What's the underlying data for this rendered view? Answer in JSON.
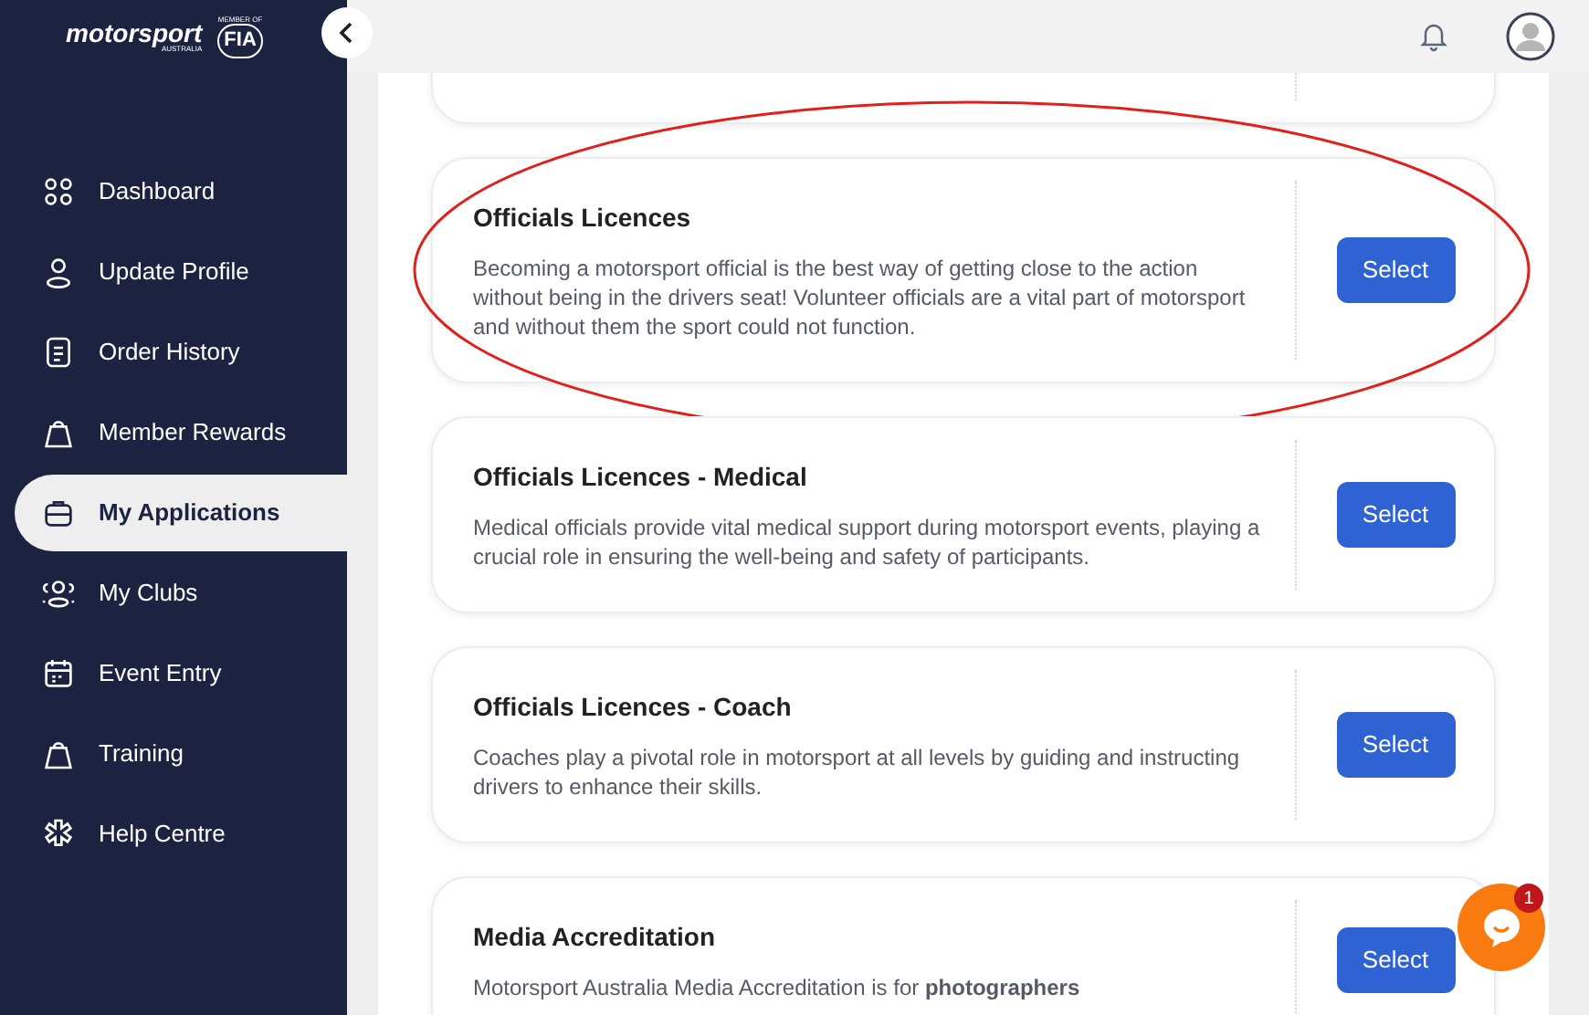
{
  "logo": {
    "wordmark": "motorsport",
    "subtitle": "AUSTRALIA",
    "member_label": "MEMBER OF",
    "fia": "FIA"
  },
  "sidebar": {
    "items": [
      {
        "label": "Dashboard",
        "selected": false
      },
      {
        "label": "Update Profile",
        "selected": false
      },
      {
        "label": "Order History",
        "selected": false
      },
      {
        "label": "Member Rewards",
        "selected": false
      },
      {
        "label": "My Applications",
        "selected": true
      },
      {
        "label": "My Clubs",
        "selected": false
      },
      {
        "label": "Event Entry",
        "selected": false
      },
      {
        "label": "Training",
        "selected": false
      },
      {
        "label": "Help Centre",
        "selected": false
      }
    ]
  },
  "cards": [
    {
      "highlighted": false
    },
    {
      "title": "Officials Licences",
      "description": "Becoming a motorsport official is the best way of getting close to the action without being in the drivers seat! Volunteer officials are a vital part of motorsport and without them the sport could not function.",
      "button": "Select",
      "highlighted": true
    },
    {
      "title": "Officials Licences - Medical",
      "description": "Medical officials provide vital medical support during motorsport events, playing a crucial role in ensuring the well-being and safety of participants.",
      "button": "Select",
      "highlighted": false
    },
    {
      "title": "Officials Licences - Coach",
      "description": "Coaches play a pivotal role in motorsport at all levels by guiding and instructing drivers to enhance their skills.",
      "button": "Select",
      "highlighted": false
    },
    {
      "title": "Media Accreditation",
      "description": "Motorsport Australia Media Accreditation is for **photographers**",
      "button": "Select",
      "highlighted": false
    }
  ],
  "chat": {
    "badge": "1"
  }
}
